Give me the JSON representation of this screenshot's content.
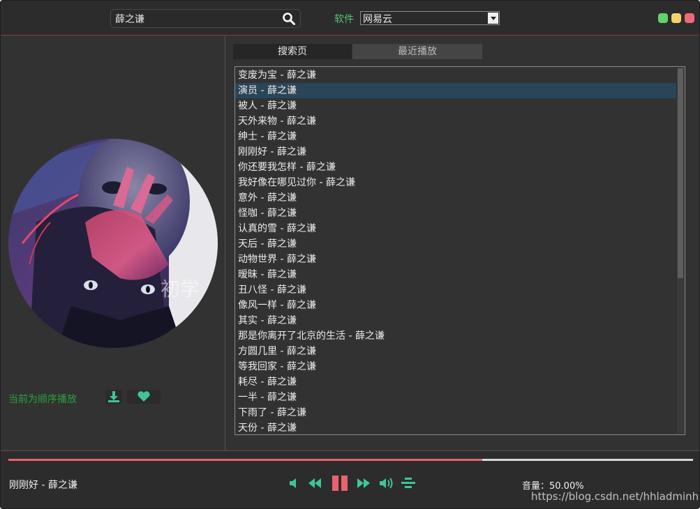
{
  "search": {
    "value": "薛之谦"
  },
  "source": {
    "label": "软件",
    "selected": "网易云"
  },
  "tabs": [
    {
      "label": "搜索页",
      "active": true
    },
    {
      "label": "最近播放",
      "active": false
    }
  ],
  "songs": [
    "变废为宝 - 薛之谦",
    "演员 - 薛之谦",
    "被人 - 薛之谦",
    "天外来物 - 薛之谦",
    "绅士 - 薛之谦",
    "刚刚好 - 薛之谦",
    "你还要我怎样 - 薛之谦",
    "我好像在哪见过你 - 薛之谦",
    "意外 - 薛之谦",
    "怪咖 - 薛之谦",
    "认真的雪 - 薛之谦",
    "天后 - 薛之谦",
    "动物世界 - 薛之谦",
    "暧昧 - 薛之谦",
    "丑八怪 - 薛之谦",
    "像风一样 - 薛之谦",
    "其实 - 薛之谦",
    "那是你离开了北京的生活 - 薛之谦",
    "方圆几里 - 薛之谦",
    "等我回家 - 薛之谦",
    "耗尽 - 薛之谦",
    "一半 - 薛之谦",
    "下雨了 - 薛之谦",
    "天份 - 薛之谦"
  ],
  "selected_song_index": 1,
  "player": {
    "play_mode": "当前为顺序播放",
    "now_playing": "刚刚好 - 薛之谦",
    "progress": 0.692,
    "volume_text": "音量：50.00%"
  },
  "cover_watermark": "初学",
  "watermark": "https://blog.csdn.net/hhladminhhl",
  "colors": {
    "accent_green": "#3ec69a",
    "progress": "#e9626d",
    "selected_row": "#2b4558",
    "mode_text": "#2aa23a"
  },
  "icons": {
    "search": "search-icon",
    "download": "download-icon",
    "like": "heart-icon",
    "volume_down": "volume-down-icon",
    "previous": "previous-icon",
    "pause": "pause-icon",
    "next": "next-icon",
    "volume_up": "volume-up-icon",
    "playlist": "playlist-icon"
  }
}
